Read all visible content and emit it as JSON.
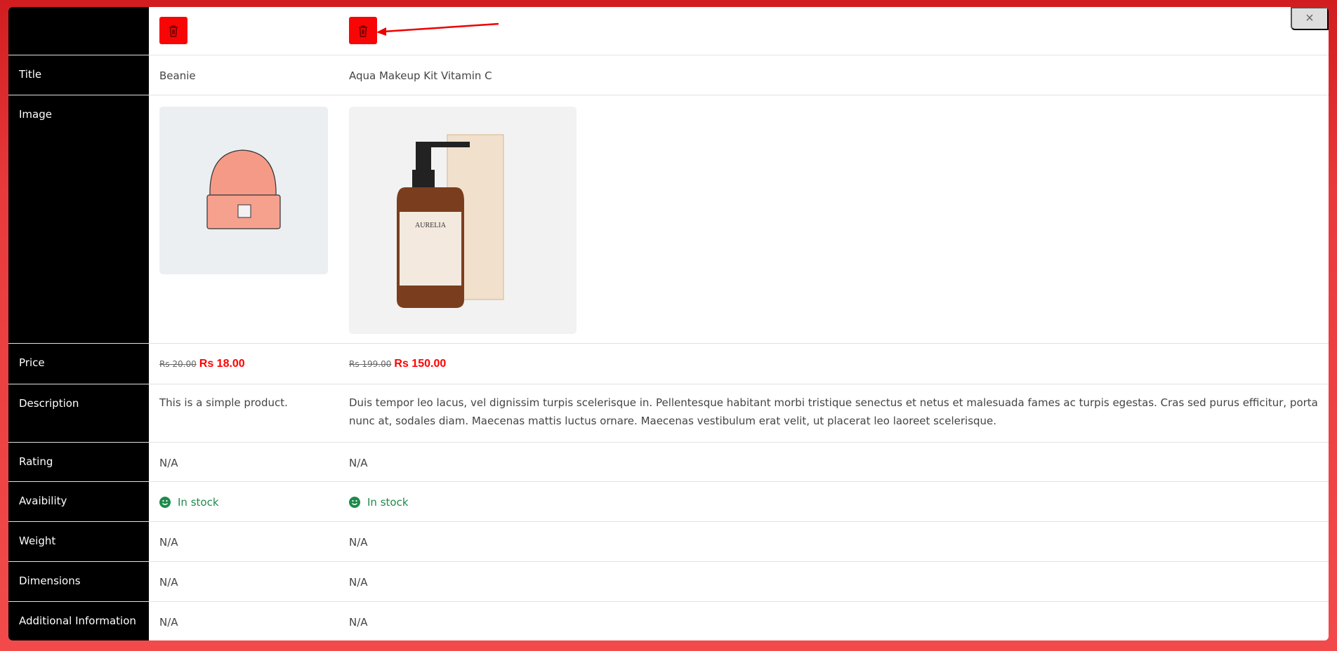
{
  "close_label": "×",
  "labels": {
    "title": "Title",
    "image": "Image",
    "price": "Price",
    "description": "Description",
    "rating": "Rating",
    "availability": "Avaibility",
    "weight": "Weight",
    "dimensions": "Dimensions",
    "additional": "Additional Information"
  },
  "products": [
    {
      "title": "Beanie",
      "image_icon": "beanie-image",
      "old_price": "Rs 20.00",
      "price": "Rs 18.00",
      "description": "This is a simple product.",
      "rating": "N/A",
      "availability": "In stock",
      "weight": "N/A",
      "dimensions": "N/A",
      "additional": "N/A"
    },
    {
      "title": "Aqua Makeup Kit Vitamin C",
      "image_icon": "cleanser-bottle-image",
      "image_brand": "AURELIA",
      "old_price": "Rs 199.00",
      "price": "Rs 150.00",
      "description": "Duis tempor leo lacus, vel dignissim turpis scelerisque in. Pellentesque habitant morbi tristique senectus et netus et malesuada fames ac turpis egestas. Cras sed purus efficitur, porta nunc at, sodales diam. Maecenas mattis luctus ornare. Maecenas vestibulum erat velit, ut placerat leo laoreet scelerisque.",
      "rating": "N/A",
      "availability": "In stock",
      "weight": "N/A",
      "dimensions": "N/A",
      "additional": "N/A"
    }
  ],
  "colors": {
    "delete": "#f80606",
    "price": "#ff0000",
    "stock": "#1e8a4c",
    "sidebar": "#000000"
  }
}
